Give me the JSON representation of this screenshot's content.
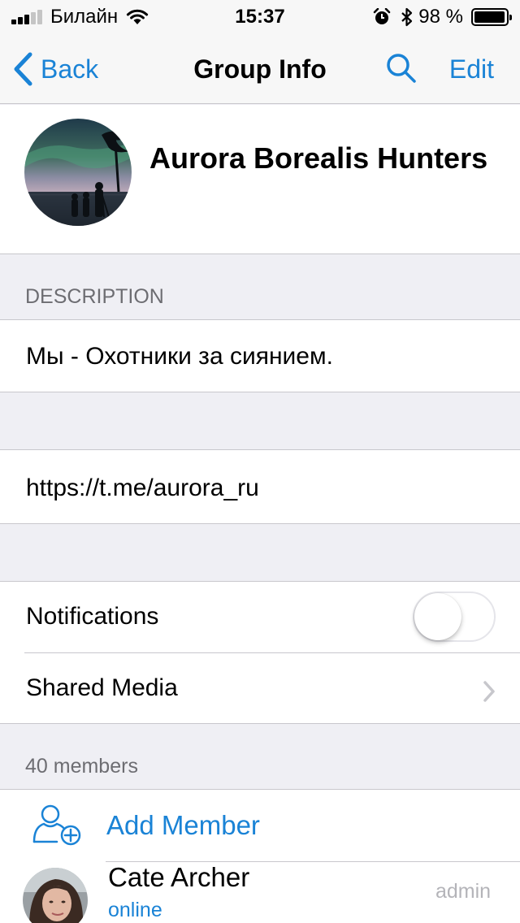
{
  "status_bar": {
    "carrier": "Билайн",
    "time": "15:37",
    "battery_percent_text": "98 %",
    "battery_level": 0.98,
    "signal_bars": 3,
    "signal_bars_total": 5
  },
  "nav": {
    "back_label": "Back",
    "title": "Group Info",
    "edit_label": "Edit"
  },
  "group": {
    "name": "Aurora Borealis Hunters"
  },
  "description": {
    "header": "DESCRIPTION",
    "text": "Мы - Охотники за сиянием."
  },
  "link": {
    "text": "https://t.me/aurora_ru"
  },
  "settings": {
    "notifications_label": "Notifications",
    "notifications_on": false,
    "shared_media_label": "Shared Media"
  },
  "members": {
    "count_label": "40 members",
    "add_member_label": "Add Member",
    "list": [
      {
        "name": "Cate Archer",
        "status": "online",
        "role": "admin"
      }
    ]
  },
  "colors": {
    "accent": "#1a83d6",
    "background": "#efeff4",
    "separator": "#c8c7cc",
    "secondary_text": "#6d6d72"
  },
  "icons": [
    "wifi-icon",
    "alarm-icon",
    "bluetooth-icon",
    "battery-icon",
    "back-chevron-icon",
    "search-icon",
    "add-member-icon",
    "chevron-right-icon"
  ]
}
